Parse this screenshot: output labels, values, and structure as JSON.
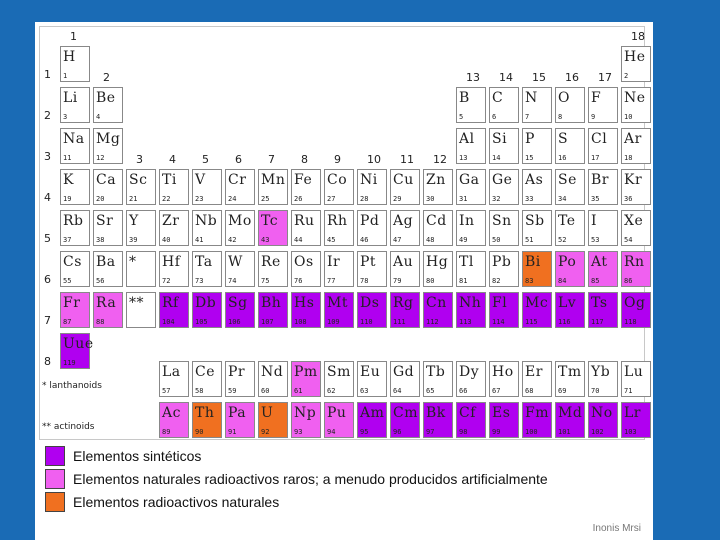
{
  "colors": {
    "background": "#1a6bb5",
    "synthetic": "#b000f0",
    "rare_radioactive": "#f060f0",
    "radioactive": "#f07020",
    "cell_default": "#ffffff"
  },
  "labels": {
    "groups": [
      "1",
      "2",
      "3",
      "4",
      "5",
      "6",
      "7",
      "8",
      "9",
      "10",
      "11",
      "12",
      "13",
      "14",
      "15",
      "16",
      "17",
      "18"
    ],
    "periods": [
      "1",
      "2",
      "3",
      "4",
      "5",
      "6",
      "7",
      "8"
    ],
    "lanthanoids_marker": "*",
    "actinoids_marker": "**",
    "lanthanoids": "* lanthanoids",
    "actinoids": "** actinoids"
  },
  "elements": [
    {
      "s": "H",
      "n": "1",
      "g": 1,
      "p": 1
    },
    {
      "s": "He",
      "n": "2",
      "g": 18,
      "p": 1
    },
    {
      "s": "Li",
      "n": "3",
      "g": 1,
      "p": 2
    },
    {
      "s": "Be",
      "n": "4",
      "g": 2,
      "p": 2
    },
    {
      "s": "B",
      "n": "5",
      "g": 13,
      "p": 2
    },
    {
      "s": "C",
      "n": "6",
      "g": 14,
      "p": 2
    },
    {
      "s": "N",
      "n": "7",
      "g": 15,
      "p": 2
    },
    {
      "s": "O",
      "n": "8",
      "g": 16,
      "p": 2
    },
    {
      "s": "F",
      "n": "9",
      "g": 17,
      "p": 2
    },
    {
      "s": "Ne",
      "n": "10",
      "g": 18,
      "p": 2
    },
    {
      "s": "Na",
      "n": "11",
      "g": 1,
      "p": 3
    },
    {
      "s": "Mg",
      "n": "12",
      "g": 2,
      "p": 3
    },
    {
      "s": "Al",
      "n": "13",
      "g": 13,
      "p": 3
    },
    {
      "s": "Si",
      "n": "14",
      "g": 14,
      "p": 3
    },
    {
      "s": "P",
      "n": "15",
      "g": 15,
      "p": 3
    },
    {
      "s": "S",
      "n": "16",
      "g": 16,
      "p": 3
    },
    {
      "s": "Cl",
      "n": "17",
      "g": 17,
      "p": 3
    },
    {
      "s": "Ar",
      "n": "18",
      "g": 18,
      "p": 3
    },
    {
      "s": "K",
      "n": "19",
      "g": 1,
      "p": 4
    },
    {
      "s": "Ca",
      "n": "20",
      "g": 2,
      "p": 4
    },
    {
      "s": "Sc",
      "n": "21",
      "g": 3,
      "p": 4
    },
    {
      "s": "Ti",
      "n": "22",
      "g": 4,
      "p": 4
    },
    {
      "s": "V",
      "n": "23",
      "g": 5,
      "p": 4
    },
    {
      "s": "Cr",
      "n": "24",
      "g": 6,
      "p": 4
    },
    {
      "s": "Mn",
      "n": "25",
      "g": 7,
      "p": 4
    },
    {
      "s": "Fe",
      "n": "26",
      "g": 8,
      "p": 4
    },
    {
      "s": "Co",
      "n": "27",
      "g": 9,
      "p": 4
    },
    {
      "s": "Ni",
      "n": "28",
      "g": 10,
      "p": 4
    },
    {
      "s": "Cu",
      "n": "29",
      "g": 11,
      "p": 4
    },
    {
      "s": "Zn",
      "n": "30",
      "g": 12,
      "p": 4
    },
    {
      "s": "Ga",
      "n": "31",
      "g": 13,
      "p": 4
    },
    {
      "s": "Ge",
      "n": "32",
      "g": 14,
      "p": 4
    },
    {
      "s": "As",
      "n": "33",
      "g": 15,
      "p": 4
    },
    {
      "s": "Se",
      "n": "34",
      "g": 16,
      "p": 4
    },
    {
      "s": "Br",
      "n": "35",
      "g": 17,
      "p": 4
    },
    {
      "s": "Kr",
      "n": "36",
      "g": 18,
      "p": 4
    },
    {
      "s": "Rb",
      "n": "37",
      "g": 1,
      "p": 5
    },
    {
      "s": "Sr",
      "n": "38",
      "g": 2,
      "p": 5
    },
    {
      "s": "Y",
      "n": "39",
      "g": 3,
      "p": 5
    },
    {
      "s": "Zr",
      "n": "40",
      "g": 4,
      "p": 5
    },
    {
      "s": "Nb",
      "n": "41",
      "g": 5,
      "p": 5
    },
    {
      "s": "Mo",
      "n": "42",
      "g": 6,
      "p": 5
    },
    {
      "s": "Tc",
      "n": "43",
      "g": 7,
      "p": 5,
      "c": "rare_radioactive"
    },
    {
      "s": "Ru",
      "n": "44",
      "g": 8,
      "p": 5
    },
    {
      "s": "Rh",
      "n": "45",
      "g": 9,
      "p": 5
    },
    {
      "s": "Pd",
      "n": "46",
      "g": 10,
      "p": 5
    },
    {
      "s": "Ag",
      "n": "47",
      "g": 11,
      "p": 5
    },
    {
      "s": "Cd",
      "n": "48",
      "g": 12,
      "p": 5
    },
    {
      "s": "In",
      "n": "49",
      "g": 13,
      "p": 5
    },
    {
      "s": "Sn",
      "n": "50",
      "g": 14,
      "p": 5
    },
    {
      "s": "Sb",
      "n": "51",
      "g": 15,
      "p": 5
    },
    {
      "s": "Te",
      "n": "52",
      "g": 16,
      "p": 5
    },
    {
      "s": "I",
      "n": "53",
      "g": 17,
      "p": 5
    },
    {
      "s": "Xe",
      "n": "54",
      "g": 18,
      "p": 5
    },
    {
      "s": "Cs",
      "n": "55",
      "g": 1,
      "p": 6
    },
    {
      "s": "Ba",
      "n": "56",
      "g": 2,
      "p": 6
    },
    {
      "s": "*",
      "n": "",
      "g": 3,
      "p": 6
    },
    {
      "s": "Hf",
      "n": "72",
      "g": 4,
      "p": 6
    },
    {
      "s": "Ta",
      "n": "73",
      "g": 5,
      "p": 6
    },
    {
      "s": "W",
      "n": "74",
      "g": 6,
      "p": 6
    },
    {
      "s": "Re",
      "n": "75",
      "g": 7,
      "p": 6
    },
    {
      "s": "Os",
      "n": "76",
      "g": 8,
      "p": 6
    },
    {
      "s": "Ir",
      "n": "77",
      "g": 9,
      "p": 6
    },
    {
      "s": "Pt",
      "n": "78",
      "g": 10,
      "p": 6
    },
    {
      "s": "Au",
      "n": "79",
      "g": 11,
      "p": 6
    },
    {
      "s": "Hg",
      "n": "80",
      "g": 12,
      "p": 6
    },
    {
      "s": "Tl",
      "n": "81",
      "g": 13,
      "p": 6
    },
    {
      "s": "Pb",
      "n": "82",
      "g": 14,
      "p": 6
    },
    {
      "s": "Bi",
      "n": "83",
      "g": 15,
      "p": 6,
      "c": "radioactive"
    },
    {
      "s": "Po",
      "n": "84",
      "g": 16,
      "p": 6,
      "c": "rare_radioactive"
    },
    {
      "s": "At",
      "n": "85",
      "g": 17,
      "p": 6,
      "c": "rare_radioactive"
    },
    {
      "s": "Rn",
      "n": "86",
      "g": 18,
      "p": 6,
      "c": "rare_radioactive"
    },
    {
      "s": "Fr",
      "n": "87",
      "g": 1,
      "p": 7,
      "c": "rare_radioactive"
    },
    {
      "s": "Ra",
      "n": "88",
      "g": 2,
      "p": 7,
      "c": "rare_radioactive"
    },
    {
      "s": "**",
      "n": "",
      "g": 3,
      "p": 7
    },
    {
      "s": "Rf",
      "n": "104",
      "g": 4,
      "p": 7,
      "c": "synthetic"
    },
    {
      "s": "Db",
      "n": "105",
      "g": 5,
      "p": 7,
      "c": "synthetic"
    },
    {
      "s": "Sg",
      "n": "106",
      "g": 6,
      "p": 7,
      "c": "synthetic"
    },
    {
      "s": "Bh",
      "n": "107",
      "g": 7,
      "p": 7,
      "c": "synthetic"
    },
    {
      "s": "Hs",
      "n": "108",
      "g": 8,
      "p": 7,
      "c": "synthetic"
    },
    {
      "s": "Mt",
      "n": "109",
      "g": 9,
      "p": 7,
      "c": "synthetic"
    },
    {
      "s": "Ds",
      "n": "110",
      "g": 10,
      "p": 7,
      "c": "synthetic"
    },
    {
      "s": "Rg",
      "n": "111",
      "g": 11,
      "p": 7,
      "c": "synthetic"
    },
    {
      "s": "Cn",
      "n": "112",
      "g": 12,
      "p": 7,
      "c": "synthetic"
    },
    {
      "s": "Nh",
      "n": "113",
      "g": 13,
      "p": 7,
      "c": "synthetic"
    },
    {
      "s": "Fl",
      "n": "114",
      "g": 14,
      "p": 7,
      "c": "synthetic"
    },
    {
      "s": "Mc",
      "n": "115",
      "g": 15,
      "p": 7,
      "c": "synthetic"
    },
    {
      "s": "Lv",
      "n": "116",
      "g": 16,
      "p": 7,
      "c": "synthetic"
    },
    {
      "s": "Ts",
      "n": "117",
      "g": 17,
      "p": 7,
      "c": "synthetic"
    },
    {
      "s": "Og",
      "n": "118",
      "g": 18,
      "p": 7,
      "c": "synthetic"
    },
    {
      "s": "Uue",
      "n": "119",
      "g": 1,
      "p": 8,
      "c": "synthetic"
    },
    {
      "s": "La",
      "n": "57",
      "g": 4,
      "p": 9
    },
    {
      "s": "Ce",
      "n": "58",
      "g": 5,
      "p": 9
    },
    {
      "s": "Pr",
      "n": "59",
      "g": 6,
      "p": 9
    },
    {
      "s": "Nd",
      "n": "60",
      "g": 7,
      "p": 9
    },
    {
      "s": "Pm",
      "n": "61",
      "g": 8,
      "p": 9,
      "c": "rare_radioactive"
    },
    {
      "s": "Sm",
      "n": "62",
      "g": 9,
      "p": 9
    },
    {
      "s": "Eu",
      "n": "63",
      "g": 10,
      "p": 9
    },
    {
      "s": "Gd",
      "n": "64",
      "g": 11,
      "p": 9
    },
    {
      "s": "Tb",
      "n": "65",
      "g": 12,
      "p": 9
    },
    {
      "s": "Dy",
      "n": "66",
      "g": 13,
      "p": 9
    },
    {
      "s": "Ho",
      "n": "67",
      "g": 14,
      "p": 9
    },
    {
      "s": "Er",
      "n": "68",
      "g": 15,
      "p": 9
    },
    {
      "s": "Tm",
      "n": "69",
      "g": 16,
      "p": 9
    },
    {
      "s": "Yb",
      "n": "70",
      "g": 17,
      "p": 9
    },
    {
      "s": "Lu",
      "n": "71",
      "g": 18,
      "p": 9
    },
    {
      "s": "Ac",
      "n": "89",
      "g": 4,
      "p": 10,
      "c": "rare_radioactive"
    },
    {
      "s": "Th",
      "n": "90",
      "g": 5,
      "p": 10,
      "c": "radioactive"
    },
    {
      "s": "Pa",
      "n": "91",
      "g": 6,
      "p": 10,
      "c": "rare_radioactive"
    },
    {
      "s": "U",
      "n": "92",
      "g": 7,
      "p": 10,
      "c": "radioactive"
    },
    {
      "s": "Np",
      "n": "93",
      "g": 8,
      "p": 10,
      "c": "rare_radioactive"
    },
    {
      "s": "Pu",
      "n": "94",
      "g": 9,
      "p": 10,
      "c": "rare_radioactive"
    },
    {
      "s": "Am",
      "n": "95",
      "g": 10,
      "p": 10,
      "c": "synthetic"
    },
    {
      "s": "Cm",
      "n": "96",
      "g": 11,
      "p": 10,
      "c": "synthetic"
    },
    {
      "s": "Bk",
      "n": "97",
      "g": 12,
      "p": 10,
      "c": "synthetic"
    },
    {
      "s": "Cf",
      "n": "98",
      "g": 13,
      "p": 10,
      "c": "synthetic"
    },
    {
      "s": "Es",
      "n": "99",
      "g": 14,
      "p": 10,
      "c": "synthetic"
    },
    {
      "s": "Fm",
      "n": "100",
      "g": 15,
      "p": 10,
      "c": "synthetic"
    },
    {
      "s": "Md",
      "n": "101",
      "g": 16,
      "p": 10,
      "c": "synthetic"
    },
    {
      "s": "No",
      "n": "102",
      "g": 17,
      "p": 10,
      "c": "synthetic"
    },
    {
      "s": "Lr",
      "n": "103",
      "g": 18,
      "p": 10,
      "c": "synthetic"
    }
  ],
  "legend": [
    {
      "label": "Elementos sintéticos",
      "color": "synthetic"
    },
    {
      "label": "Elementos naturales radioactivos raros; a menudo producidos artificialmente",
      "color": "rare_radioactive"
    },
    {
      "label": "Elementos radioactivos naturales",
      "color": "radioactive"
    }
  ],
  "credit": "Inonis Mrsi"
}
